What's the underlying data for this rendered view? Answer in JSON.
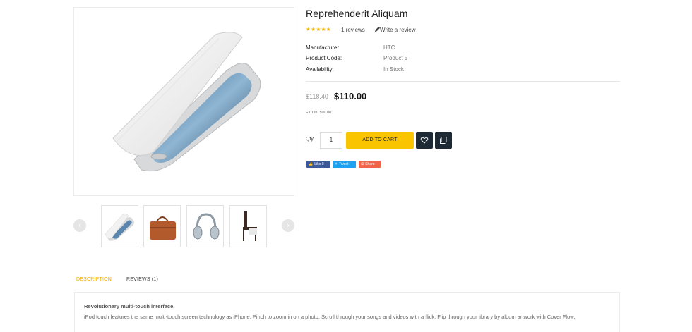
{
  "product": {
    "title": "Reprehenderit Aliquam",
    "rating_stars": "★★★★★",
    "rating_value": 5,
    "reviews_text": "1 reviews",
    "write_review": "Write a review",
    "specs": [
      {
        "label": "Manufacturer",
        "value": "HTC"
      },
      {
        "label": "Product Code:",
        "value": "Product 5"
      },
      {
        "label": "Availability:",
        "value": "In Stock"
      }
    ],
    "old_price": "$118.40",
    "new_price": "$110.00",
    "ex_tax": "Ex Tax: $90.00",
    "qty_label": "Qty",
    "qty_value": "1",
    "add_to_cart": "ADD TO CART",
    "social": {
      "like": "Like 0",
      "tweet": "Tweet",
      "share": "Share"
    }
  },
  "gallery": {
    "prev_arrow": "‹",
    "next_arrow": "›",
    "thumbnails": [
      "phone-case-thumb",
      "brown-bag-thumb",
      "headphones-thumb",
      "chair-thumb"
    ]
  },
  "tabs": [
    {
      "label": "DESCRIPTION",
      "active": true
    },
    {
      "label": "REVIEWS (1)",
      "active": false
    }
  ],
  "description": {
    "heading": "Revolutionary multi-touch interface.",
    "body": "iPod touch features the same multi-touch screen technology as iPhone. Pinch to zoom in on a photo. Scroll through your songs and videos with a flick. Flip through your library by album artwork with Cover Flow."
  },
  "colors": {
    "accent": "#fbc400",
    "tab_active": "#f2a900",
    "dark_button": "#1d2a36",
    "star": "#f6b800",
    "facebook": "#3b5998",
    "twitter": "#1da1f2",
    "share": "#f0654a"
  }
}
